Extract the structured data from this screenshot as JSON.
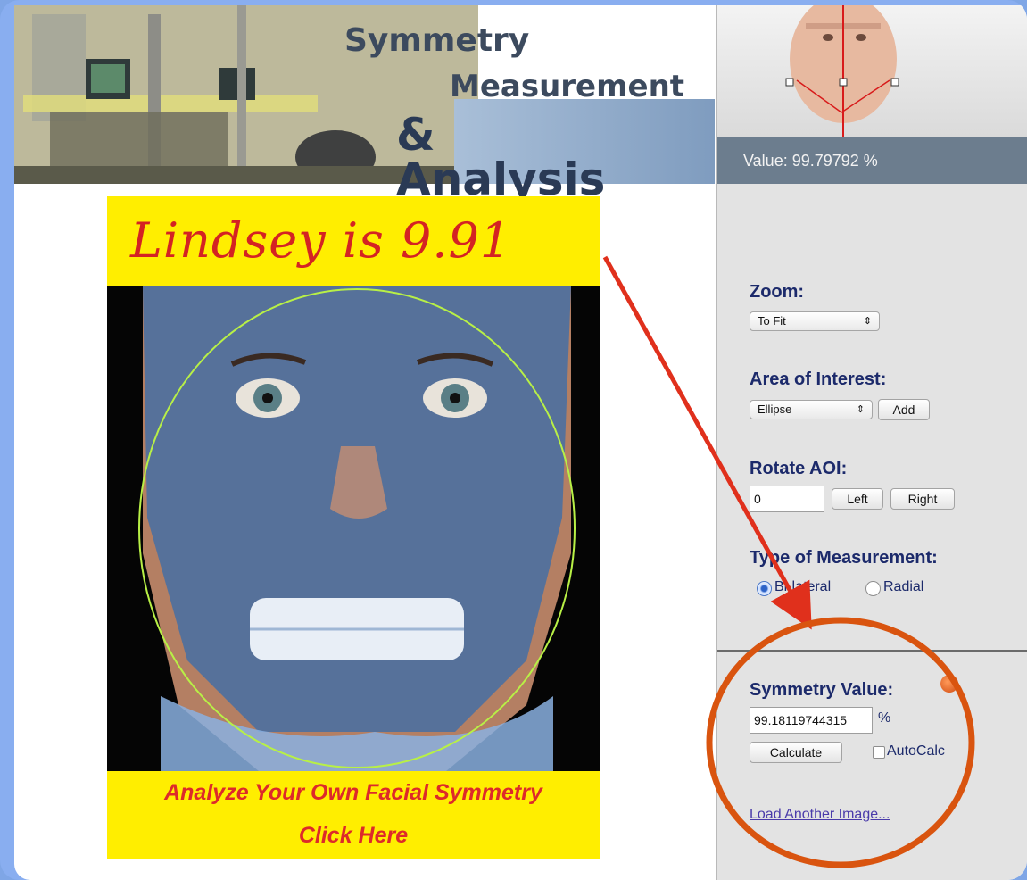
{
  "header": {
    "title_line1": "Symmetry",
    "title_line2": "Measurement",
    "title_line3": "& Analysis",
    "value_text": "Value: 99.79792 %"
  },
  "image_panel": {
    "top_banner": "Lindsey is 9.91",
    "cta_line1": "Analyze Your Own Facial Symmetry",
    "cta_line2": "Click Here"
  },
  "controls": {
    "zoom_label": "Zoom:",
    "zoom_value": "To Fit",
    "aoi_label": "Area of Interest:",
    "aoi_value": "Ellipse",
    "add_button": "Add",
    "rotate_label": "Rotate AOI:",
    "rotate_value": "0",
    "left_button": "Left",
    "right_button": "Right",
    "measurement_label": "Type of Measurement:",
    "option_bilateral": "Bi-lateral",
    "option_radial": "Radial",
    "selected_option": "Bi-lateral",
    "symmetry_label": "Symmetry Value:",
    "symmetry_value": "99.18119744315",
    "percent_sign": "%",
    "calculate_button": "Calculate",
    "autocalc_label": "AutoCalc",
    "autocalc_checked": false,
    "load_link": "Load Another Image..."
  },
  "colors": {
    "banner_yellow": "#ffee00",
    "script_red": "#d42323",
    "annotation_arrow": "#e0301c",
    "annotation_circle": "#d9540f",
    "label_navy": "#1c2a6b"
  }
}
